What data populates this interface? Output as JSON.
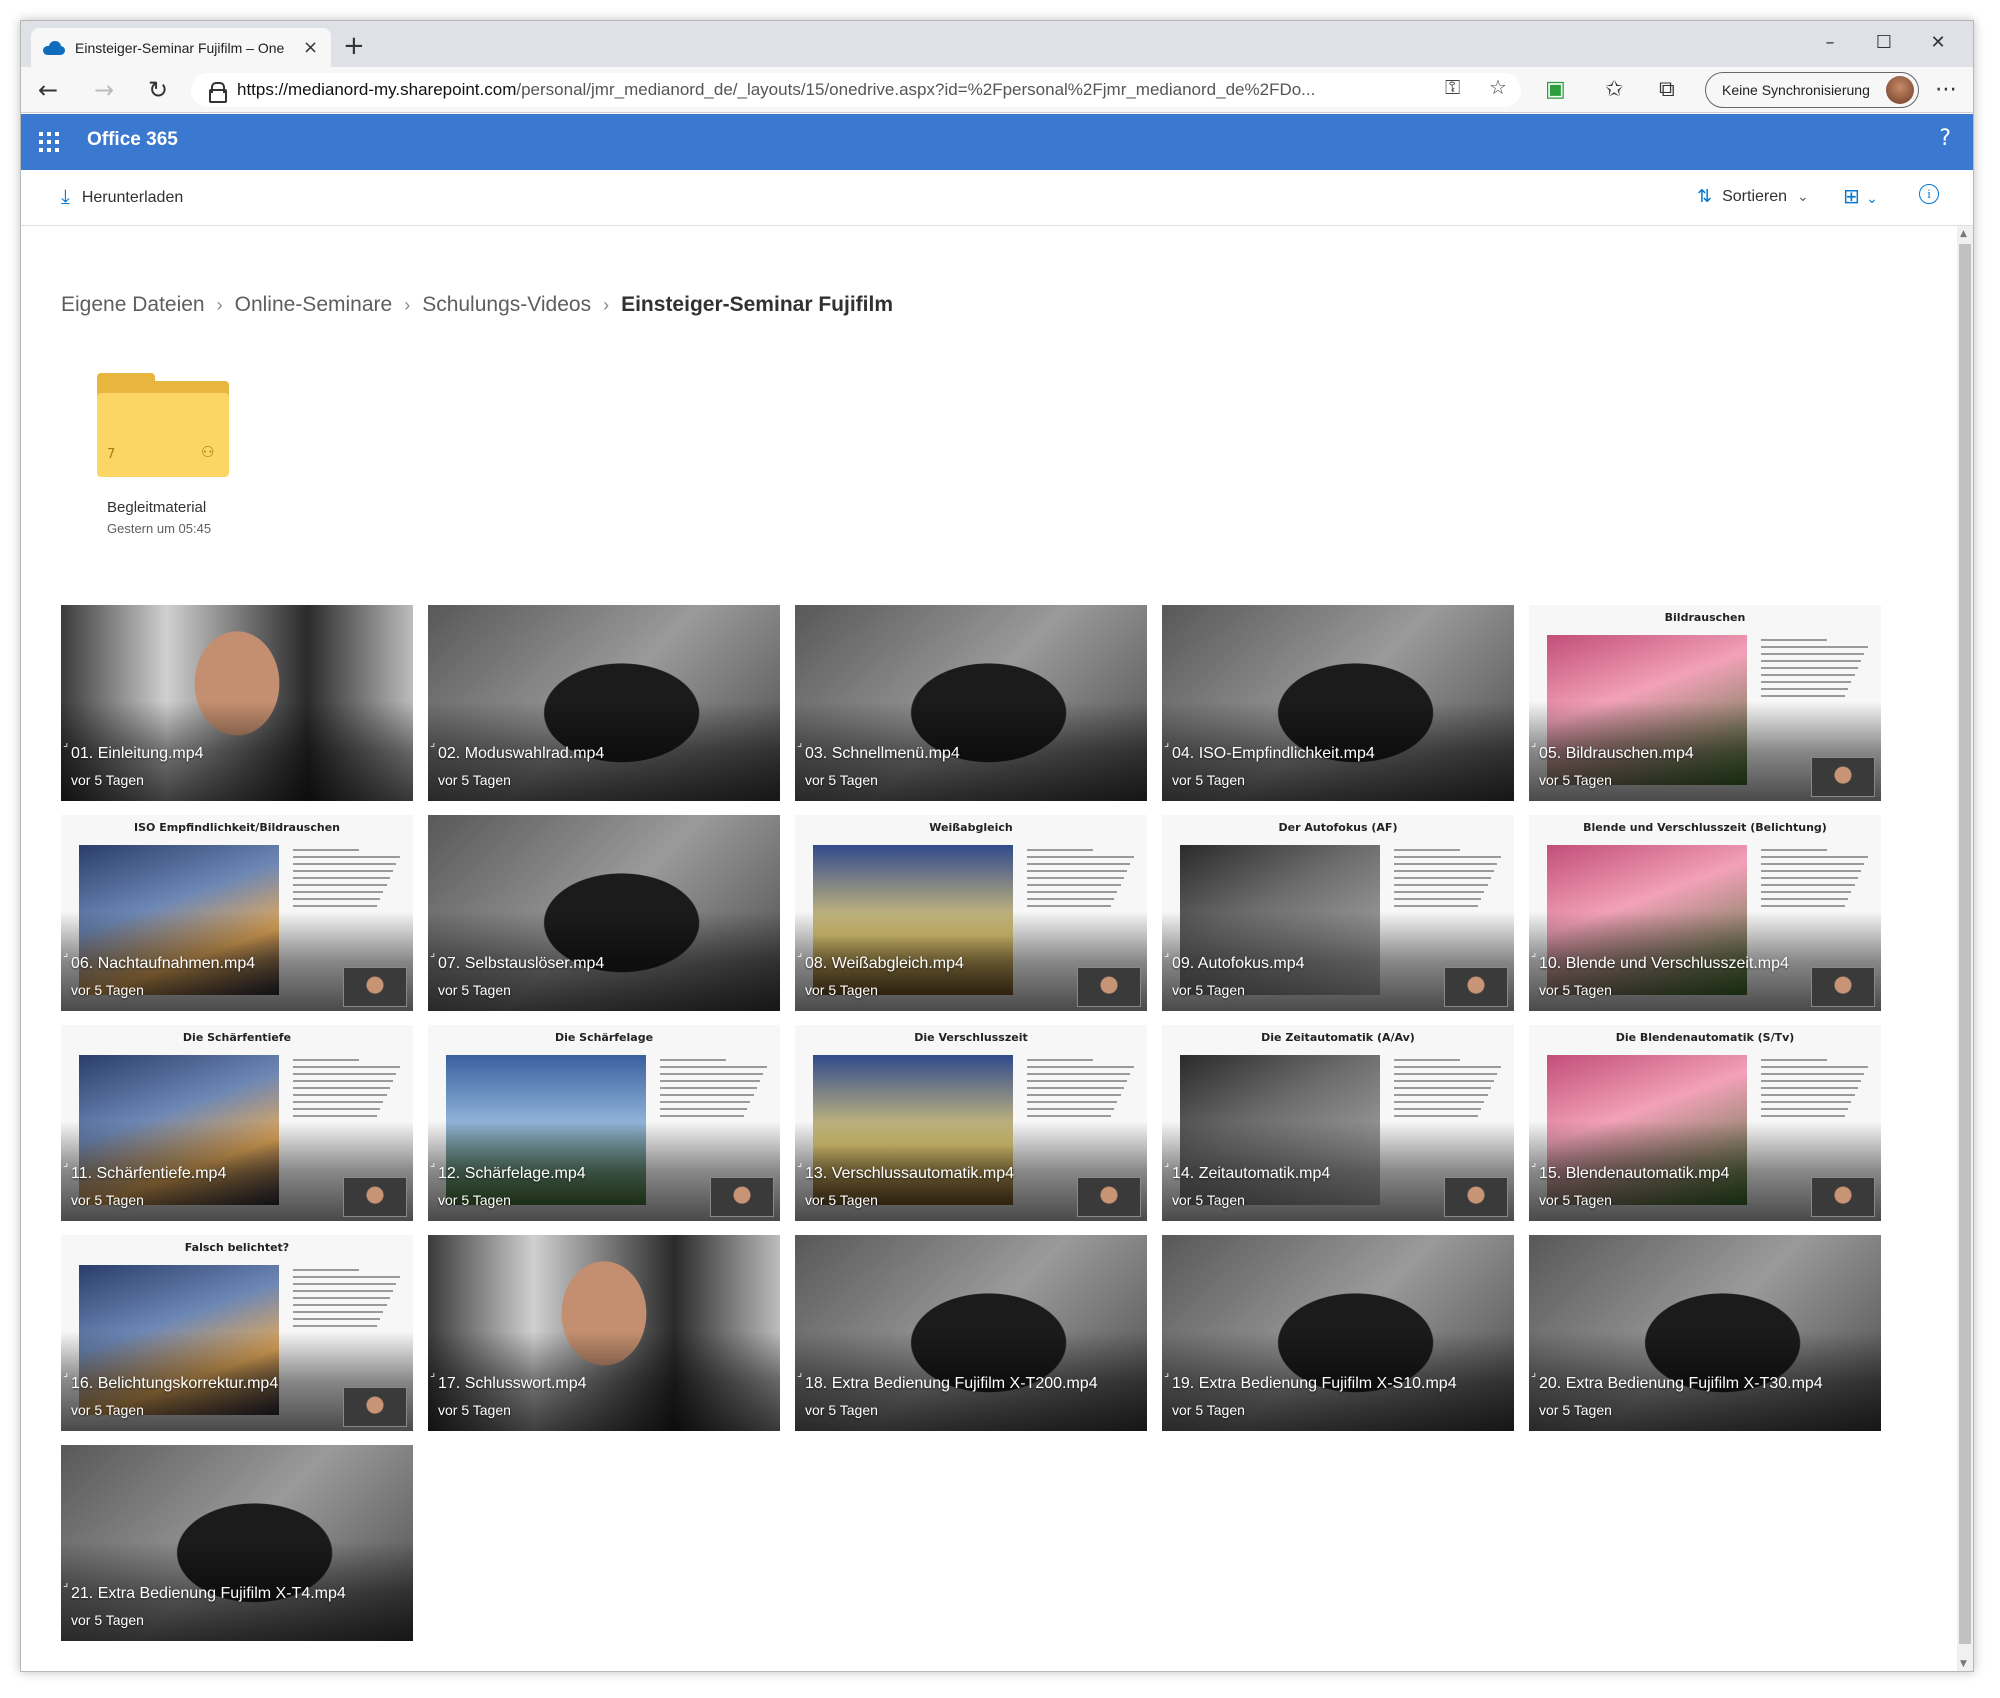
{
  "browser": {
    "tab_title": "Einsteiger-Seminar Fujifilm – One",
    "tab_close": "×",
    "new_tab": "+",
    "url_host": "https://medianord-my.sharepoint.com",
    "url_path": "/personal/jmr_medianord_de/_layouts/15/onedrive.aspx?id=%2Fpersonal%2Fjmr_medianord_de%2FDo...",
    "sync_label": "Keine Synchronisierung",
    "window_controls": {
      "minimize": "–",
      "maximize": "☐",
      "close": "✕"
    }
  },
  "office": {
    "title": "Office 365",
    "help": "?"
  },
  "commandbar": {
    "download_label": "Herunterladen",
    "sort_label": "Sortieren"
  },
  "breadcrumb": [
    "Eigene Dateien",
    "Online-Seminare",
    "Schulungs-Videos",
    "Einsteiger-Seminar Fujifilm"
  ],
  "folder": {
    "name": "Begleitmaterial",
    "date": "Gestern um 05:45",
    "count": "7"
  },
  "videos": [
    {
      "name": "01. Einleitung.mp4",
      "date": "vor 5 Tagen",
      "kind": "person",
      "slide_title": ""
    },
    {
      "name": "02. Moduswahlrad.mp4",
      "date": "vor 5 Tagen",
      "kind": "camera",
      "slide_title": ""
    },
    {
      "name": "03. Schnellmenü.mp4",
      "date": "vor 5 Tagen",
      "kind": "camera",
      "slide_title": ""
    },
    {
      "name": "04. ISO-Empfindlichkeit.mp4",
      "date": "vor 5 Tagen",
      "kind": "camera",
      "slide_title": ""
    },
    {
      "name": "05. Bildrauschen.mp4",
      "date": "vor 5 Tagen",
      "kind": "slide",
      "slide_title": "Bildrauschen"
    },
    {
      "name": "06. Nachtaufnahmen.mp4",
      "date": "vor 5 Tagen",
      "kind": "slide",
      "slide_title": "ISO Empfindlichkeit/Bildrauschen"
    },
    {
      "name": "07. Selbstauslöser.mp4",
      "date": "vor 5 Tagen",
      "kind": "camera",
      "slide_title": ""
    },
    {
      "name": "08. Weißabgleich.mp4",
      "date": "vor 5 Tagen",
      "kind": "slide",
      "slide_title": "Weißabgleich"
    },
    {
      "name": "09. Autofokus.mp4",
      "date": "vor 5 Tagen",
      "kind": "slide",
      "slide_title": "Der Autofokus (AF)"
    },
    {
      "name": "10. Blende und Verschlusszeit.mp4",
      "date": "vor 5 Tagen",
      "kind": "slide",
      "slide_title": "Blende und Verschlusszeit (Belichtung)"
    },
    {
      "name": "11. Schärfentiefe.mp4",
      "date": "vor 5 Tagen",
      "kind": "slide",
      "slide_title": "Die Schärfentiefe"
    },
    {
      "name": "12. Schärfelage.mp4",
      "date": "vor 5 Tagen",
      "kind": "slide",
      "slide_title": "Die Schärfelage"
    },
    {
      "name": "13. Verschlussautomatik.mp4",
      "date": "vor 5 Tagen",
      "kind": "slide",
      "slide_title": "Die Verschlusszeit"
    },
    {
      "name": "14. Zeitautomatik.mp4",
      "date": "vor 5 Tagen",
      "kind": "slide",
      "slide_title": "Die Zeitautomatik (A/Av)"
    },
    {
      "name": "15. Blendenautomatik.mp4",
      "date": "vor 5 Tagen",
      "kind": "slide",
      "slide_title": "Die Blendenautomatik (S/Tv)"
    },
    {
      "name": "16. Belichtungskorrektur.mp4",
      "date": "vor 5 Tagen",
      "kind": "slide",
      "slide_title": "Falsch belichtet?"
    },
    {
      "name": "17. Schlusswort.mp4",
      "date": "vor 5 Tagen",
      "kind": "person",
      "slide_title": ""
    },
    {
      "name": "18. Extra Bedienung Fujifilm X-T200.mp4",
      "date": "vor 5 Tagen",
      "kind": "camera",
      "slide_title": ""
    },
    {
      "name": "19. Extra Bedienung Fujifilm X-S10.mp4",
      "date": "vor 5 Tagen",
      "kind": "camera",
      "slide_title": ""
    },
    {
      "name": "20. Extra Bedienung Fujifilm X-T30.mp4",
      "date": "vor 5 Tagen",
      "kind": "camera",
      "slide_title": ""
    },
    {
      "name": "21. Extra Bedienung Fujifilm X-T4.mp4",
      "date": "vor 5 Tagen",
      "kind": "camera",
      "slide_title": ""
    }
  ],
  "icons": {
    "back": "back-arrow-icon",
    "forward": "forward-arrow-icon",
    "reload": "reload-icon",
    "lock": "lock-icon",
    "waffle": "app-launcher-icon",
    "download": "download-icon",
    "sort": "sort-icon",
    "view": "view-switcher-icon",
    "info": "info-icon"
  },
  "colors": {
    "office_header": "#3b78cf",
    "accent": "#0078d4",
    "folder_front": "#fbd665",
    "folder_back": "#e8b53e"
  }
}
